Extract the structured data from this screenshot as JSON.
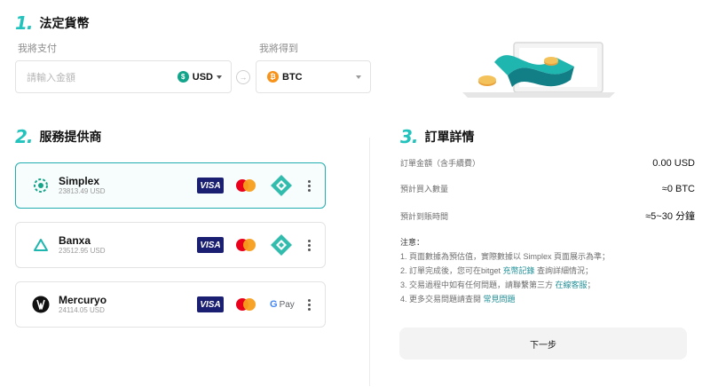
{
  "fiat": {
    "step_number": "1.",
    "title": "法定貨幣",
    "pay_label": "我將支付",
    "receive_label": "我將得到",
    "amount_placeholder": "請輸入金額",
    "pay_currency": "USD",
    "pay_currency_symbol": "$",
    "receive_currency": "BTC",
    "receive_currency_symbol": "₿"
  },
  "providers_section": {
    "step_number": "2.",
    "title": "服務提供商",
    "providers": [
      {
        "name": "Simplex",
        "rate": "23813.49 USD",
        "selected": true,
        "methods": [
          "visa-icon",
          "mastercard-icon",
          "pix-icon"
        ]
      },
      {
        "name": "Banxa",
        "rate": "23512.95 USD",
        "selected": false,
        "methods": [
          "visa-icon",
          "mastercard-icon",
          "pix-icon"
        ]
      },
      {
        "name": "Mercuryo",
        "rate": "24114.05 USD",
        "selected": false,
        "methods": [
          "visa-icon",
          "mastercard-icon",
          "google-pay-icon"
        ]
      }
    ],
    "visa_text": "VISA",
    "gpay_text": "Pay",
    "gpay_g": "G"
  },
  "order": {
    "step_number": "3.",
    "title": "訂單詳情",
    "rows": [
      {
        "key": "訂單金額（含手續費）",
        "value": "0.00 USD"
      },
      {
        "key": "預計買入數量",
        "value": "≈0 BTC"
      },
      {
        "key": "預計到賬時間",
        "value": "≈5~30 分鐘"
      }
    ],
    "notes_title": "注意：",
    "notes": {
      "n1": "1. 頁面數據為預估值，實際數據以 Simplex 頁面展示為準；",
      "n2_pre": "2. 訂單完成後，您可在bitget ",
      "n2_link": "充幣記錄",
      "n2_post": " 查詢詳細情況；",
      "n3_pre": "3. 交易過程中如有任何問題，請聯繫第三方 ",
      "n3_link": "在線客服",
      "n3_post": "；",
      "n4_pre": "4. 更多交易問題請查閱 ",
      "n4_link": "常見問題"
    },
    "next_button": "下一步"
  },
  "colors": {
    "accent": "#22c3bd",
    "link": "#1f8f97",
    "selected_border": "#22aeb0"
  }
}
